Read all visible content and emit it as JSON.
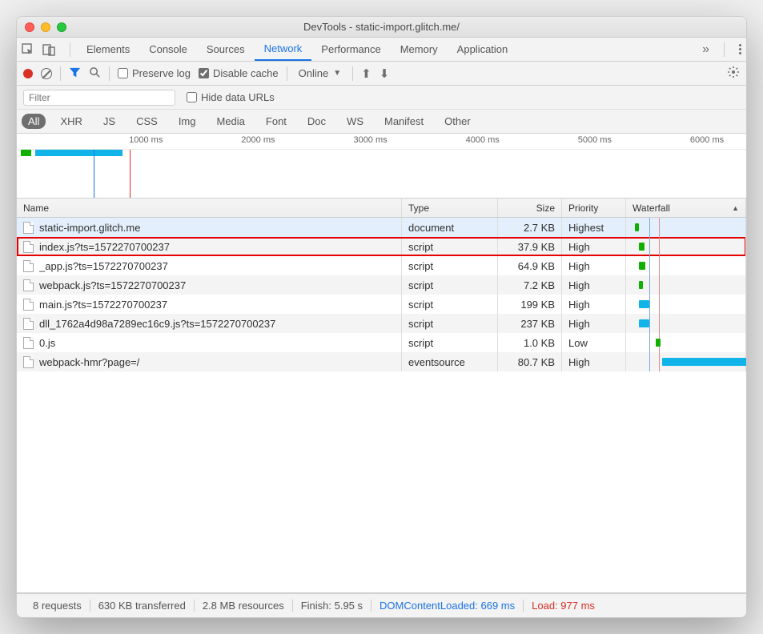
{
  "window": {
    "title": "DevTools - static-import.glitch.me/"
  },
  "tabs": {
    "items": [
      "Elements",
      "Console",
      "Sources",
      "Network",
      "Performance",
      "Memory",
      "Application"
    ],
    "active": "Network"
  },
  "toolbar": {
    "preserve_log": "Preserve log",
    "disable_cache": "Disable cache",
    "online": "Online"
  },
  "filterbar": {
    "filter_placeholder": "Filter",
    "hide_data_urls": "Hide data URLs"
  },
  "types": {
    "items": [
      "All",
      "XHR",
      "JS",
      "CSS",
      "Img",
      "Media",
      "Font",
      "Doc",
      "WS",
      "Manifest",
      "Other"
    ],
    "active": "All"
  },
  "timeline": {
    "ticks": [
      "1000 ms",
      "2000 ms",
      "3000 ms",
      "4000 ms",
      "5000 ms",
      "6000 ms"
    ]
  },
  "columns": {
    "name": "Name",
    "type": "Type",
    "size": "Size",
    "priority": "Priority",
    "waterfall": "Waterfall"
  },
  "rows": [
    {
      "name": "static-import.glitch.me",
      "type": "document",
      "size": "2.7 KB",
      "priority": "Highest",
      "sel": true,
      "hl": false,
      "wf": {
        "start": 2,
        "len": 4,
        "color": "#0fb001"
      }
    },
    {
      "name": "index.js?ts=1572270700237",
      "type": "script",
      "size": "37.9 KB",
      "priority": "High",
      "sel": false,
      "hl": true,
      "wf": {
        "start": 6,
        "len": 5,
        "color": "#0fb001"
      }
    },
    {
      "name": "_app.js?ts=1572270700237",
      "type": "script",
      "size": "64.9 KB",
      "priority": "High",
      "sel": false,
      "hl": false,
      "wf": {
        "start": 6,
        "len": 6,
        "color": "#0fb001"
      }
    },
    {
      "name": "webpack.js?ts=1572270700237",
      "type": "script",
      "size": "7.2 KB",
      "priority": "High",
      "sel": false,
      "hl": false,
      "wf": {
        "start": 6,
        "len": 4,
        "color": "#0fb001"
      }
    },
    {
      "name": "main.js?ts=1572270700237",
      "type": "script",
      "size": "199 KB",
      "priority": "High",
      "sel": false,
      "hl": false,
      "wf": {
        "start": 6,
        "len": 10,
        "color": "#11b4e8"
      }
    },
    {
      "name": "dll_1762a4d98a7289ec16c9.js?ts=1572270700237",
      "type": "script",
      "size": "237 KB",
      "priority": "High",
      "sel": false,
      "hl": false,
      "wf": {
        "start": 6,
        "len": 10,
        "color": "#11b4e8"
      }
    },
    {
      "name": "0.js",
      "type": "script",
      "size": "1.0 KB",
      "priority": "Low",
      "sel": false,
      "hl": false,
      "wf": {
        "start": 22,
        "len": 4,
        "color": "#0fb001"
      }
    },
    {
      "name": "webpack-hmr?page=/",
      "type": "eventsource",
      "size": "80.7 KB",
      "priority": "High",
      "sel": false,
      "hl": false,
      "wf": {
        "start": 28,
        "len": 120,
        "color": "#11b4e8"
      }
    }
  ],
  "status": {
    "requests": "8 requests",
    "transferred": "630 KB transferred",
    "resources": "2.8 MB resources",
    "finish": "Finish: 5.95 s",
    "dcl": "DOMContentLoaded: 669 ms",
    "load": "Load: 977 ms"
  }
}
